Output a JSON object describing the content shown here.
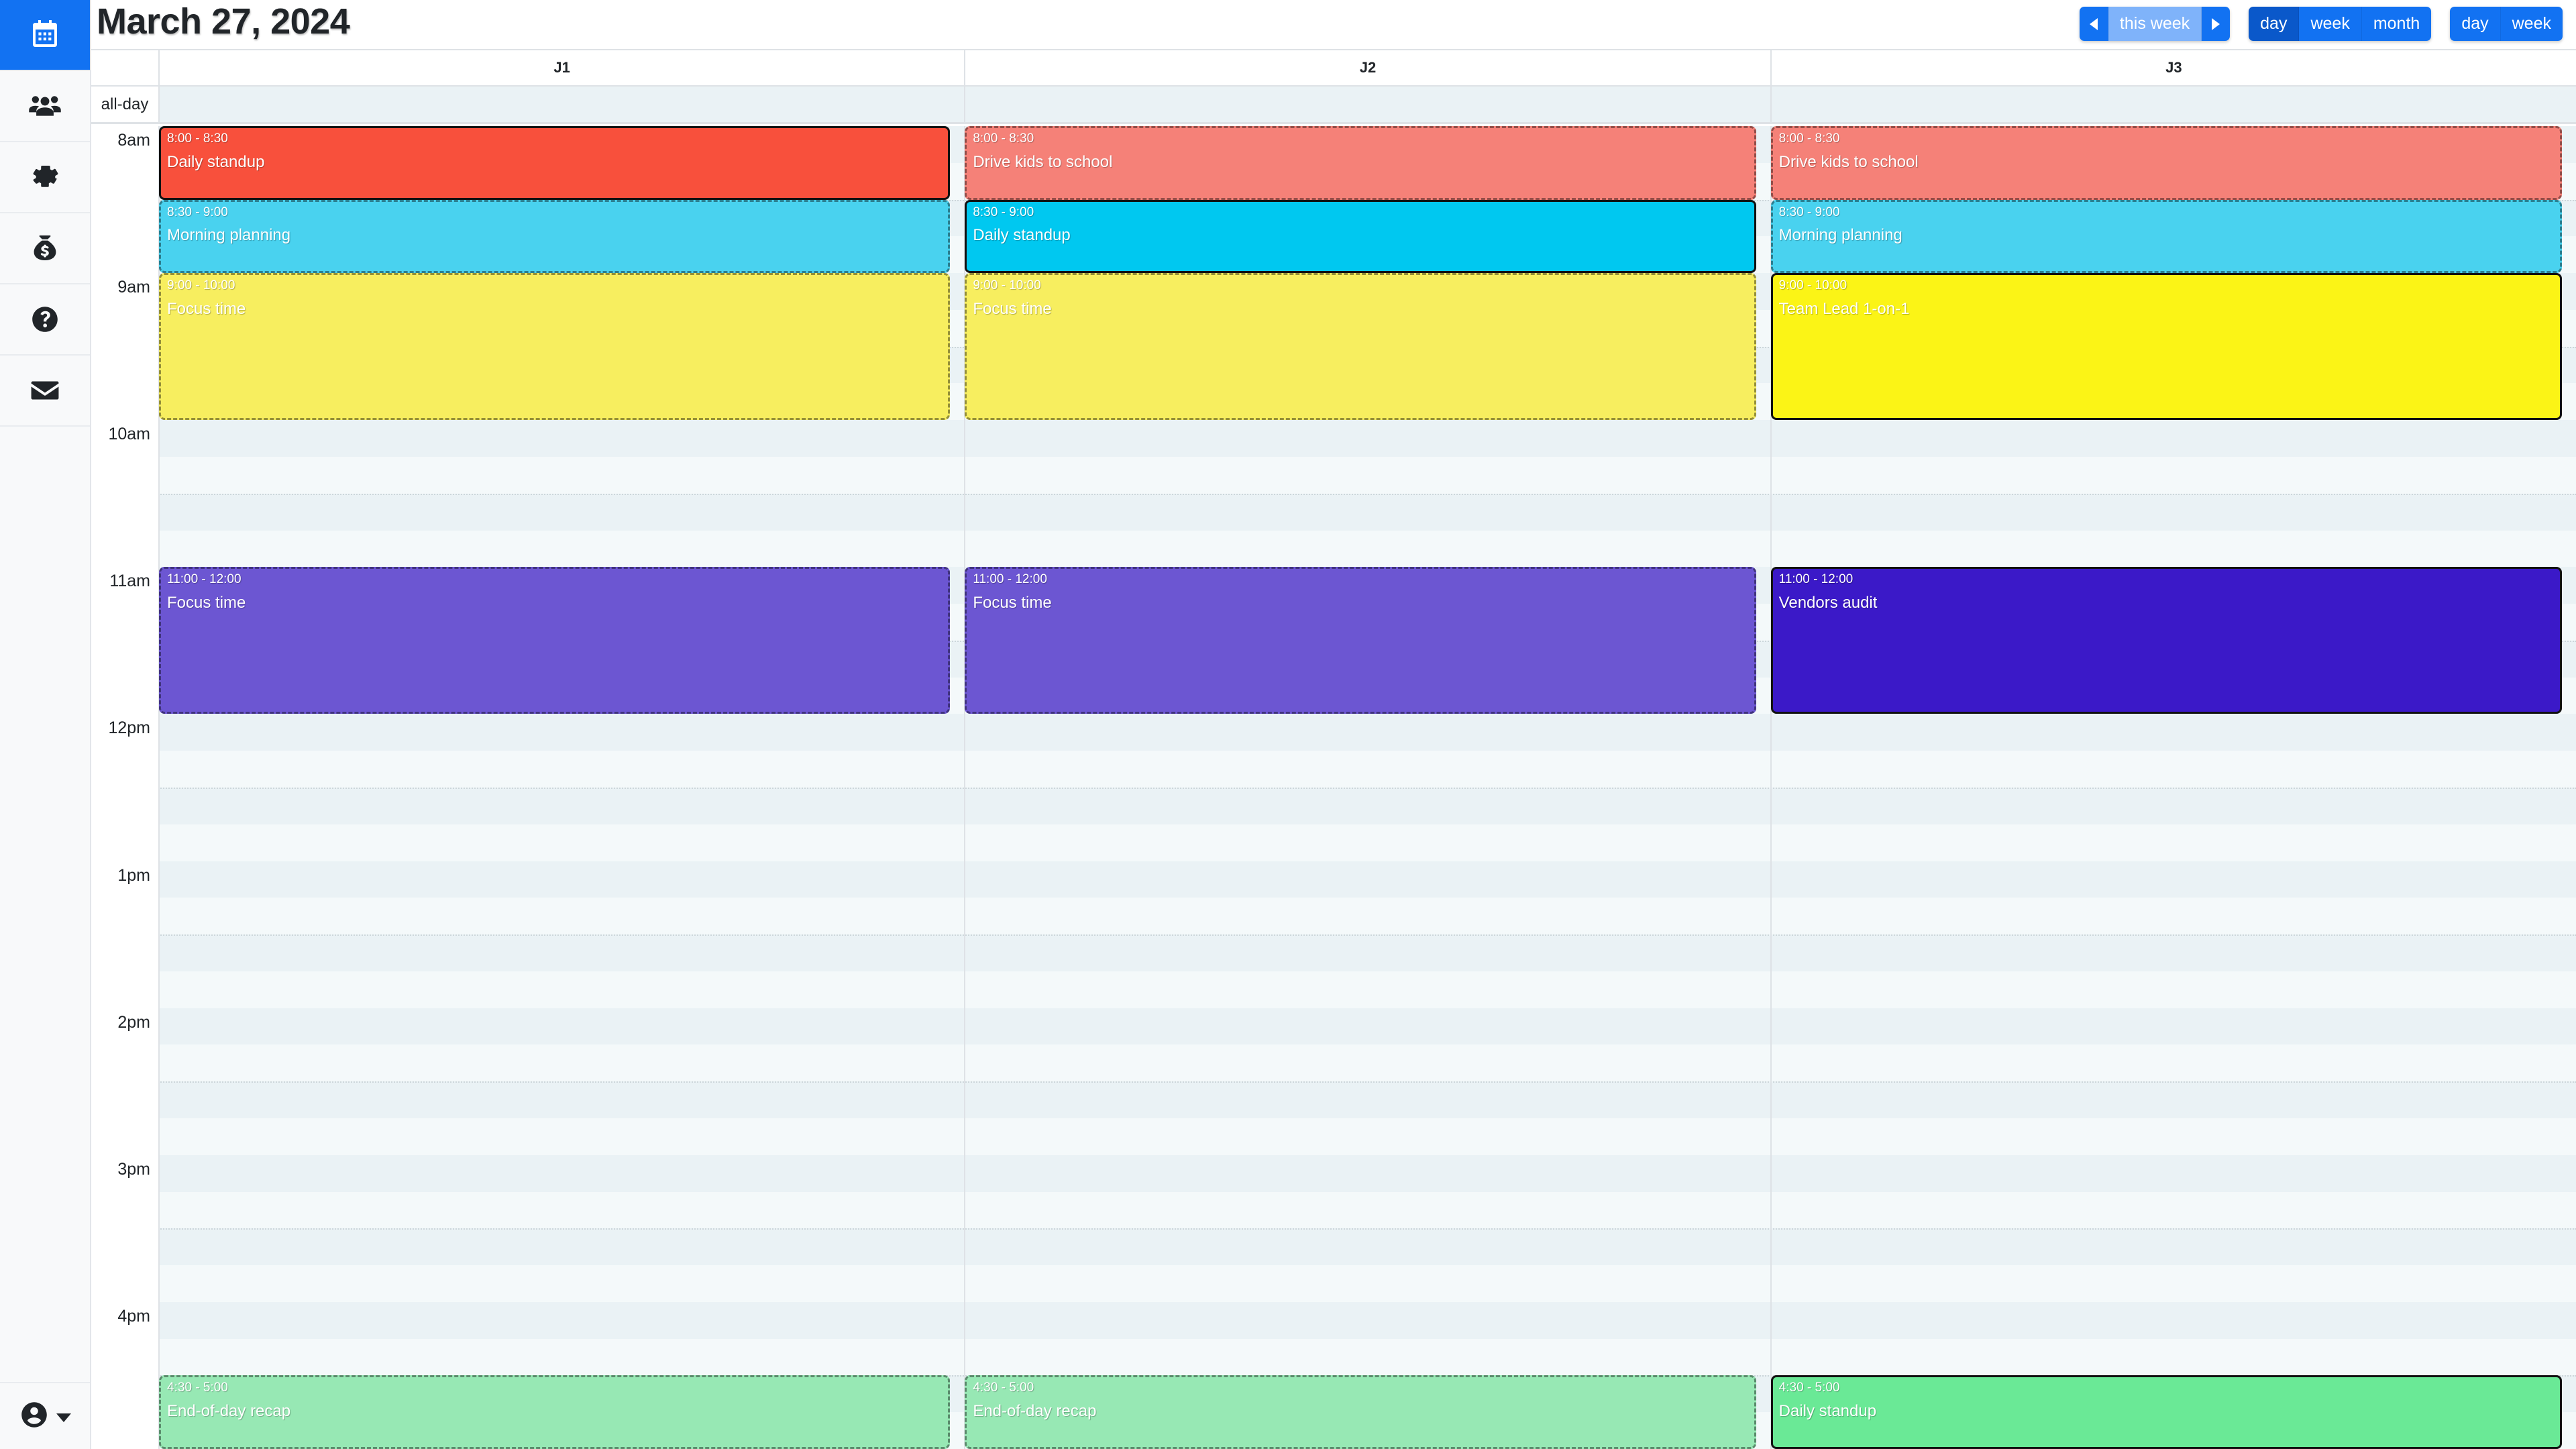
{
  "header": {
    "title": "March 27, 2024"
  },
  "toolbar": {
    "prev_label": "◀",
    "range_label": "this week",
    "next_label": "▶",
    "view_group_1": [
      "day",
      "week",
      "month"
    ],
    "view_group_2": [
      "day",
      "week"
    ],
    "active_view": "day",
    "accent_color": "#1272f2",
    "active_color": "#0a58ca",
    "highlight_color": "#7fb3fa"
  },
  "sidebar": {
    "items": [
      {
        "icon": "calendar-icon",
        "name": "calendar",
        "active": true
      },
      {
        "icon": "people-icon",
        "name": "people",
        "active": false
      },
      {
        "icon": "gear-icon",
        "name": "settings",
        "active": false
      },
      {
        "icon": "money-bag-icon",
        "name": "billing",
        "active": false
      },
      {
        "icon": "question-circle-icon",
        "name": "help",
        "active": false
      },
      {
        "icon": "envelope-icon",
        "name": "messages",
        "active": false
      }
    ],
    "footer": {
      "icon": "user-circle-icon",
      "name": "account-menu"
    }
  },
  "calendar": {
    "allday_label": "all-day",
    "columns": [
      "J1",
      "J2",
      "J3"
    ],
    "hours": [
      "8am",
      "9am",
      "10am",
      "11am",
      "12pm",
      "1pm",
      "2pm",
      "3pm",
      "4pm"
    ],
    "slot_minutes": 15,
    "colors": {
      "grid_bg": "#eaf2f5",
      "stripe_bg": "#f4f9fa",
      "line": "#dee2e6",
      "dotted_line": "#ccd6da",
      "red_solid": "#f8503c",
      "red_faded": "#f58178",
      "cyan_solid": "#00c8f0",
      "cyan_faded": "#49d2ef",
      "yellow_solid": "#fbf416",
      "yellow_faded": "#f7ee5f",
      "purple_solid": "#3b19c8",
      "purple_faded": "#6c56d2",
      "green_solid": "#6ae996",
      "green_faded": "#97e8b4"
    },
    "events": [
      {
        "column": "J1",
        "time": "8:00 - 8:30",
        "title": "Daily standup",
        "start": "08:00",
        "end": "08:30",
        "color": "#f8503c",
        "selected": true
      },
      {
        "column": "J1",
        "time": "8:30 - 9:00",
        "title": "Morning planning",
        "start": "08:30",
        "end": "09:00",
        "color": "#49d2ef",
        "selected": false
      },
      {
        "column": "J1",
        "time": "9:00 - 10:00",
        "title": "Focus time",
        "start": "09:00",
        "end": "10:00",
        "color": "#f7ee5f",
        "selected": false
      },
      {
        "column": "J1",
        "time": "11:00 - 12:00",
        "title": "Focus time",
        "start": "11:00",
        "end": "12:00",
        "color": "#6c56d2",
        "selected": false
      },
      {
        "column": "J1",
        "time": "4:30 - 5:00",
        "title": "End-of-day recap",
        "start": "16:30",
        "end": "17:00",
        "color": "#97e8b4",
        "selected": false
      },
      {
        "column": "J2",
        "time": "8:00 - 8:30",
        "title": "Drive kids to school",
        "start": "08:00",
        "end": "08:30",
        "color": "#f58178",
        "selected": false
      },
      {
        "column": "J2",
        "time": "8:30 - 9:00",
        "title": "Daily standup",
        "start": "08:30",
        "end": "09:00",
        "color": "#00c8f0",
        "selected": true
      },
      {
        "column": "J2",
        "time": "9:00 - 10:00",
        "title": "Focus time",
        "start": "09:00",
        "end": "10:00",
        "color": "#f7ee5f",
        "selected": false
      },
      {
        "column": "J2",
        "time": "11:00 - 12:00",
        "title": "Focus time",
        "start": "11:00",
        "end": "12:00",
        "color": "#6c56d2",
        "selected": false
      },
      {
        "column": "J2",
        "time": "4:30 - 5:00",
        "title": "End-of-day recap",
        "start": "16:30",
        "end": "17:00",
        "color": "#97e8b4",
        "selected": false
      },
      {
        "column": "J3",
        "time": "8:00 - 8:30",
        "title": "Drive kids to school",
        "start": "08:00",
        "end": "08:30",
        "color": "#f58178",
        "selected": false
      },
      {
        "column": "J3",
        "time": "8:30 - 9:00",
        "title": "Morning planning",
        "start": "08:30",
        "end": "09:00",
        "color": "#49d2ef",
        "selected": false
      },
      {
        "column": "J3",
        "time": "9:00 - 10:00",
        "title": "Team Lead 1-on-1",
        "start": "09:00",
        "end": "10:00",
        "color": "#fbf416",
        "selected": true
      },
      {
        "column": "J3",
        "time": "11:00 - 12:00",
        "title": "Vendors audit",
        "start": "11:00",
        "end": "12:00",
        "color": "#3b19c8",
        "selected": true
      },
      {
        "column": "J3",
        "time": "4:30 - 5:00",
        "title": "Daily standup",
        "start": "16:30",
        "end": "17:00",
        "color": "#6ae996",
        "selected": true
      }
    ]
  }
}
